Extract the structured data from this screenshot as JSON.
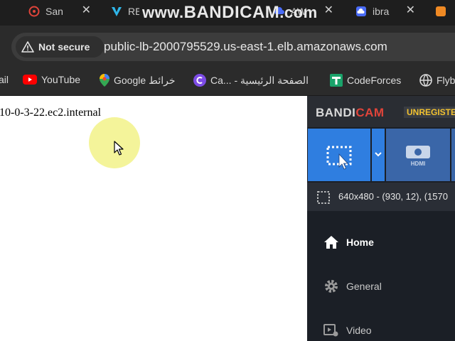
{
  "watermark": {
    "text_www": "www.",
    "text_brand": "BANDICAM",
    "text_com": ".com"
  },
  "tabs": [
    {
      "label": "San",
      "icon": "settings-app-icon",
      "color": "#e0443a"
    },
    {
      "label": "RE",
      "icon": "v-logo-icon",
      "color": "#2fb6ea"
    },
    {
      "label": "AW",
      "icon": "cloud-icon",
      "color": "#4a6cf7"
    },
    {
      "label": "ibra",
      "icon": "cloud-icon",
      "color": "#4a6cf7"
    },
    {
      "label": "",
      "icon": "orange-app-icon",
      "color": "#f08a24"
    }
  ],
  "tab_close_glyph": "✕",
  "address": {
    "security_label": "Not secure",
    "url": "public-lb-2000795529.us-east-1.elb.amazonaws.com"
  },
  "bookmarks": [
    {
      "label": "ail",
      "icon": ""
    },
    {
      "label": "YouTube",
      "icon": "youtube-icon"
    },
    {
      "label": "Google خرائط",
      "icon": "google-maps-icon"
    },
    {
      "label": "Ca... - الصفحة الرئيسية",
      "icon": "canva-icon"
    },
    {
      "label": "CodeForces",
      "icon": "codeforces-icon"
    },
    {
      "label": "Flyb",
      "icon": "globe-icon"
    }
  ],
  "page": {
    "hostname_text": "10-0-3-22.ec2.internal"
  },
  "bandicam": {
    "logo_main": "BANDI",
    "logo_accent": "CAM",
    "unregistered": "UNREGISTE",
    "status_text": "640x480 - (930, 12), (1570",
    "nav": {
      "home": "Home",
      "general": "General",
      "video": "Video"
    },
    "accent_color": "#2f7ee0"
  }
}
